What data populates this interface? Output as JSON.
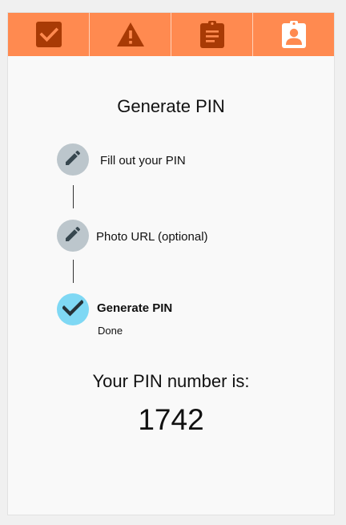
{
  "tabs": [
    {
      "icon": "checkbox-icon",
      "active": true
    },
    {
      "icon": "warning-icon",
      "active": false
    },
    {
      "icon": "clipboard-icon",
      "active": false
    },
    {
      "icon": "contact-badge-icon",
      "active": false
    }
  ],
  "colors": {
    "tab_bg": "#ff8a50",
    "tab_icon": "#a83a05",
    "step_edit_bg": "#bcc6cc",
    "step_done_bg": "#7fd8f4"
  },
  "title": "Generate PIN",
  "steps": [
    {
      "label": "Fill out your PIN",
      "icon": "pencil-icon",
      "state": "completed"
    },
    {
      "label": "Photo URL (optional)",
      "icon": "pencil-icon",
      "state": "completed"
    },
    {
      "label": "Generate PIN",
      "icon": "check-icon",
      "state": "active",
      "sub": "Done"
    }
  ],
  "pin": {
    "caption": "Your PIN number is:",
    "value": "1742"
  }
}
